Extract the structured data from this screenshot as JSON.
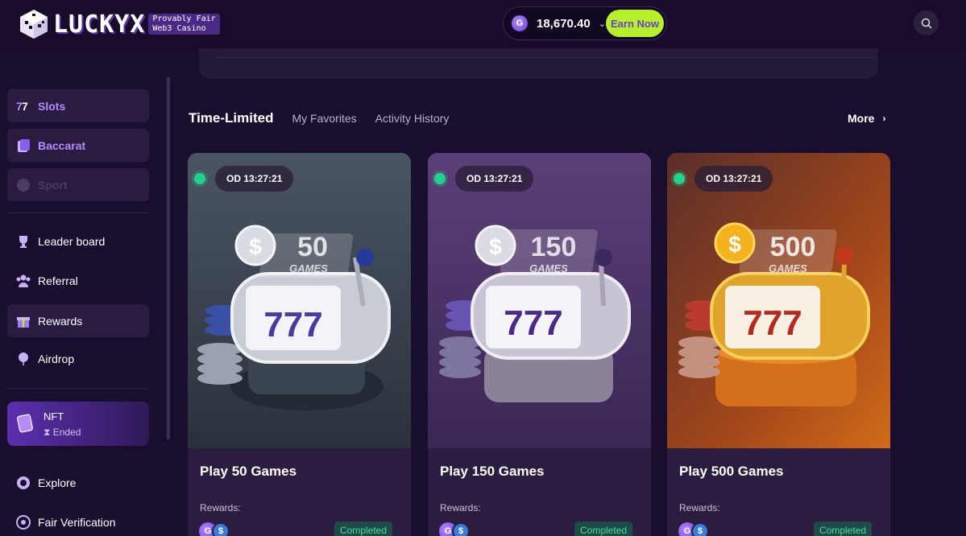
{
  "brand": {
    "name": "LUCKYX",
    "tag_line1": "Provably Fair",
    "tag_line2": "Web3 Casino"
  },
  "header": {
    "balance": "18,670.40",
    "earn_label": "Earn Now"
  },
  "sidebar": {
    "items": [
      {
        "label": "Slots",
        "icon": "slots-icon"
      },
      {
        "label": "Baccarat",
        "icon": "cards-icon"
      },
      {
        "label": "Sport",
        "icon": "ball-icon"
      },
      {
        "label": "Leader board",
        "icon": "trophy-icon"
      },
      {
        "label": "Referral",
        "icon": "people-icon"
      },
      {
        "label": "Rewards",
        "icon": "gift-icon"
      },
      {
        "label": "Airdrop",
        "icon": "balloon-icon"
      },
      {
        "label": "Explore",
        "icon": "chip-icon"
      },
      {
        "label": "Fair Verification",
        "icon": "verify-icon"
      }
    ],
    "nft": {
      "title": "NFT",
      "status": "⧗ Ended"
    }
  },
  "tabs": [
    {
      "label": "Time-Limited",
      "active": true
    },
    {
      "label": "My Favorites",
      "active": false
    },
    {
      "label": "Activity History",
      "active": false
    }
  ],
  "more_label": "More",
  "cards": [
    {
      "timer": "OD 13:27:21",
      "title": "Play 50 Games",
      "rewards_label": "Rewards:",
      "status": "Completed",
      "art_number": "50",
      "art_word": "GAMES",
      "theme": "silver"
    },
    {
      "timer": "OD 13:27:21",
      "title": "Play 150 Games",
      "rewards_label": "Rewards:",
      "status": "Completed",
      "art_number": "150",
      "art_word": "GAMES",
      "theme": "purple"
    },
    {
      "timer": "OD 13:27:21",
      "title": "Play 500 Games",
      "rewards_label": "Rewards:",
      "status": "Completed",
      "art_number": "500",
      "art_word": "GAMES",
      "theme": "orange"
    }
  ],
  "colors": {
    "bg": "#1a0e2e",
    "accent": "#b58bff",
    "earn": "#b6f02a",
    "completed": "#3ee0a0"
  }
}
